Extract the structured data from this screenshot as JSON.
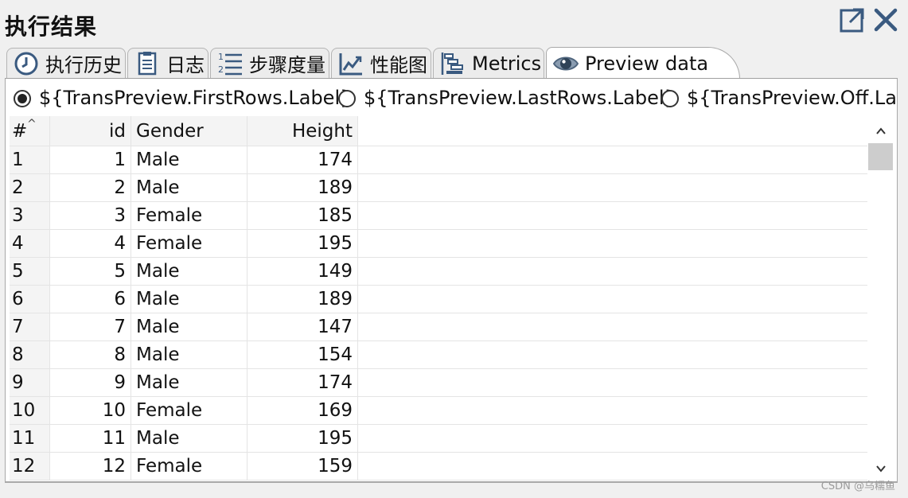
{
  "window": {
    "title": "执行结果"
  },
  "tabs": [
    {
      "label": "执行历史",
      "icon": "clock-icon"
    },
    {
      "label": "日志",
      "icon": "log-document-icon"
    },
    {
      "label": "步骤度量",
      "icon": "numbered-list-icon"
    },
    {
      "label": "性能图",
      "icon": "line-chart-icon"
    },
    {
      "label": "Metrics",
      "icon": "gantt-icon"
    },
    {
      "label": "Preview data",
      "icon": "eye-icon",
      "active": true
    }
  ],
  "preview_options": [
    {
      "label": "${TransPreview.FirstRows.Label}",
      "checked": true
    },
    {
      "label": "${TransPreview.LastRows.Label}",
      "checked": false
    },
    {
      "label": "${TransPreview.Off.Label}",
      "checked": false
    }
  ],
  "table": {
    "columns": [
      "#",
      "id",
      "Gender",
      "Height"
    ],
    "rows": [
      [
        "1",
        "1",
        "Male",
        "174"
      ],
      [
        "2",
        "2",
        "Male",
        "189"
      ],
      [
        "3",
        "3",
        "Female",
        "185"
      ],
      [
        "4",
        "4",
        "Female",
        "195"
      ],
      [
        "5",
        "5",
        "Male",
        "149"
      ],
      [
        "6",
        "6",
        "Male",
        "189"
      ],
      [
        "7",
        "7",
        "Male",
        "147"
      ],
      [
        "8",
        "8",
        "Male",
        "154"
      ],
      [
        "9",
        "9",
        "Male",
        "174"
      ],
      [
        "10",
        "10",
        "Female",
        "169"
      ],
      [
        "11",
        "11",
        "Male",
        "195"
      ],
      [
        "12",
        "12",
        "Female",
        "159"
      ]
    ]
  },
  "watermark": "CSDN @乌糯鱼",
  "colors": {
    "panel_bg": "#f0f0f0",
    "tab_icon_blue": "#3a5a80",
    "eye_icon": "#6a7f96"
  }
}
